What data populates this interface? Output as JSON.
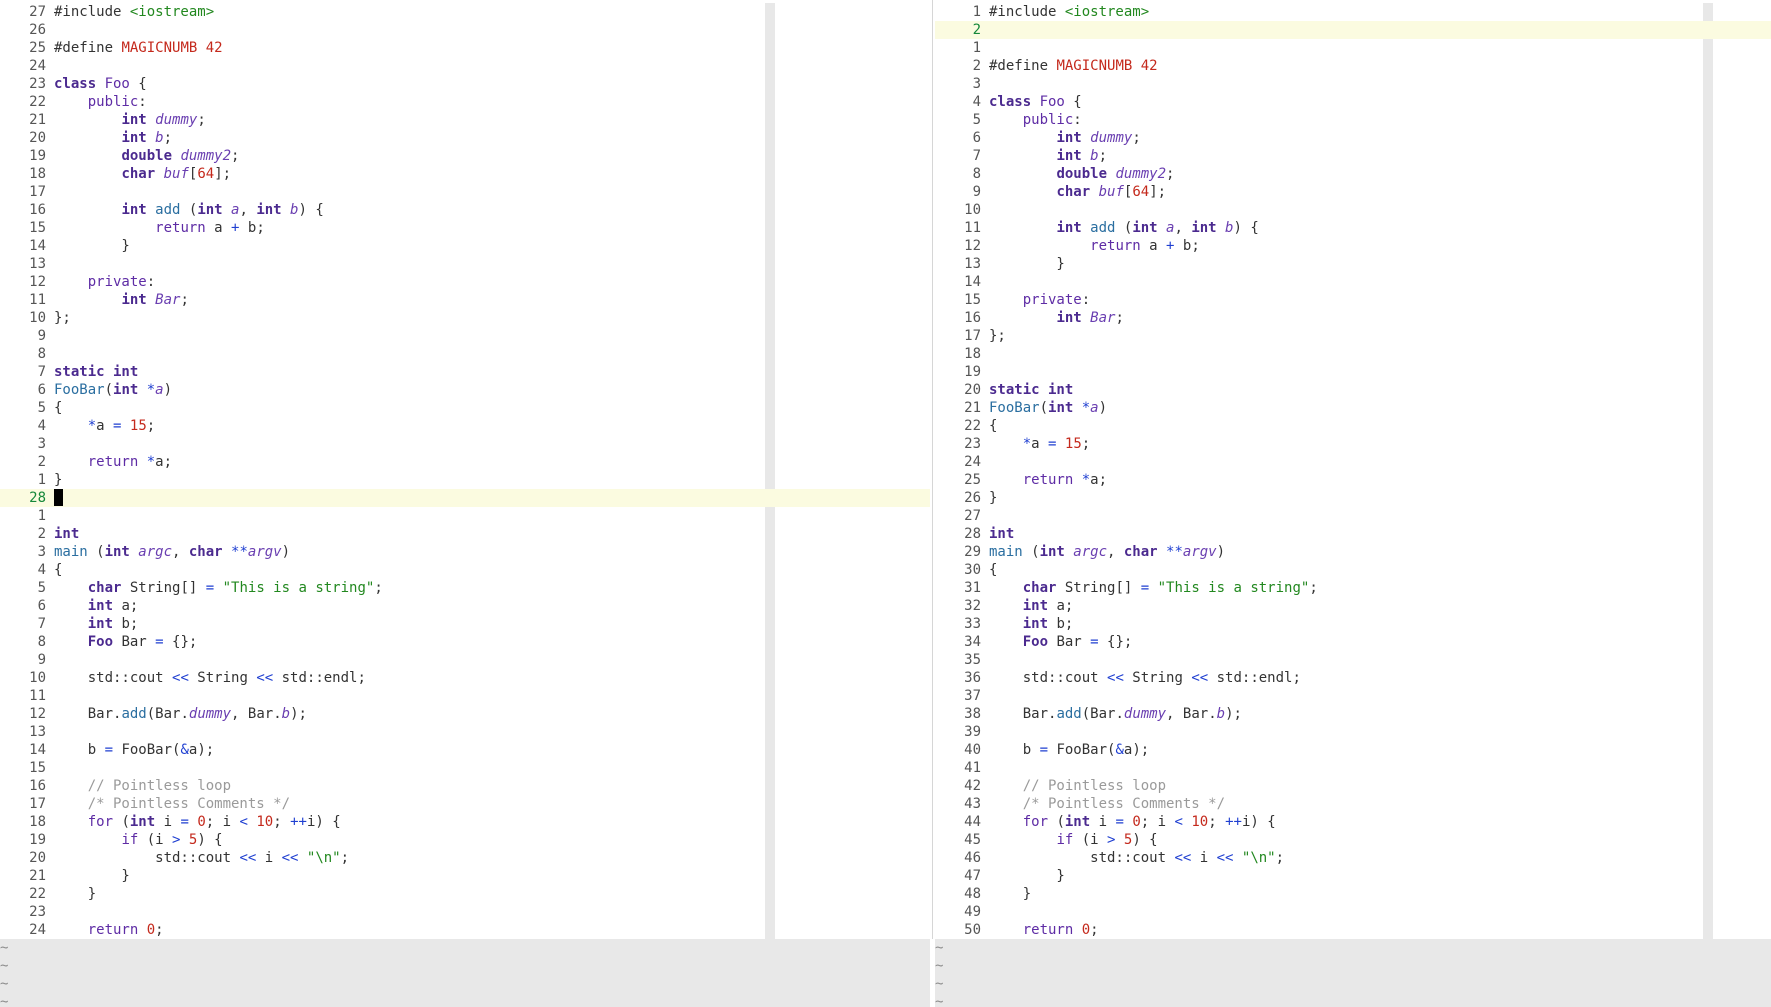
{
  "left_pane": {
    "relnumbers": [
      "27",
      "26",
      "25",
      "24",
      "23",
      "22",
      "21",
      "20",
      "19",
      "18",
      "17",
      "16",
      "15",
      "14",
      "13",
      "12",
      "11",
      "10",
      "9",
      "8",
      "7",
      "6",
      "5",
      "4",
      "3",
      "2",
      "1",
      "28",
      "1",
      "2",
      "3",
      "4",
      "5",
      "6",
      "7",
      "8",
      "9",
      "10",
      "11",
      "12",
      "13",
      "14",
      "15",
      "16",
      "17",
      "18",
      "19",
      "20",
      "21",
      "22",
      "23",
      "24"
    ],
    "cursor_line": "28",
    "tildes": [
      "~",
      "~",
      "~",
      "~"
    ]
  },
  "right_pane": {
    "numbers": [
      "1",
      "2",
      "1",
      "2",
      "3",
      "4",
      "5",
      "6",
      "7",
      "8",
      "9",
      "10",
      "11",
      "12",
      "13",
      "14",
      "15",
      "16",
      "17",
      "18",
      "19",
      "20",
      "21",
      "22",
      "23",
      "24",
      "25",
      "26",
      "27",
      "28",
      "29",
      "30",
      "31",
      "32",
      "33",
      "34",
      "35",
      "36",
      "37",
      "38",
      "39",
      "40",
      "41",
      "42",
      "43",
      "44",
      "45",
      "46",
      "47",
      "48",
      "49",
      "50"
    ],
    "tildes": [
      "~",
      "~",
      "~",
      "~"
    ]
  },
  "code": [
    [
      [
        "pp",
        "#include "
      ],
      [
        "inc",
        "<iostream>"
      ]
    ],
    [],
    [
      [
        "pp",
        "#define "
      ],
      [
        "n",
        "MAGICNUMB 42"
      ]
    ],
    [],
    [
      [
        "k",
        "class "
      ],
      [
        "t",
        "Foo"
      ],
      [
        "pp",
        " {"
      ]
    ],
    [
      [
        "pp",
        "    "
      ],
      [
        "t",
        "public"
      ],
      [
        "pp",
        ":"
      ]
    ],
    [
      [
        "pp",
        "        "
      ],
      [
        "k",
        "int "
      ],
      [
        "v",
        "dummy"
      ],
      [
        "pp",
        ";"
      ]
    ],
    [
      [
        "pp",
        "        "
      ],
      [
        "k",
        "int "
      ],
      [
        "v",
        "b"
      ],
      [
        "pp",
        ";"
      ]
    ],
    [
      [
        "pp",
        "        "
      ],
      [
        "k",
        "double "
      ],
      [
        "v",
        "dummy2"
      ],
      [
        "pp",
        ";"
      ]
    ],
    [
      [
        "pp",
        "        "
      ],
      [
        "k",
        "char "
      ],
      [
        "v",
        "buf"
      ],
      [
        "pp",
        "["
      ],
      [
        "n",
        "64"
      ],
      [
        "pp",
        "];"
      ]
    ],
    [],
    [
      [
        "pp",
        "        "
      ],
      [
        "k",
        "int "
      ],
      [
        "f",
        "add"
      ],
      [
        "pp",
        " ("
      ],
      [
        "k",
        "int "
      ],
      [
        "v",
        "a"
      ],
      [
        "pp",
        ", "
      ],
      [
        "k",
        "int "
      ],
      [
        "v",
        "b"
      ],
      [
        "pp",
        ") {"
      ]
    ],
    [
      [
        "pp",
        "            "
      ],
      [
        "t",
        "return"
      ],
      [
        "pp",
        " a "
      ],
      [
        "o",
        "+"
      ],
      [
        "pp",
        " b;"
      ]
    ],
    [
      [
        "pp",
        "        }"
      ]
    ],
    [],
    [
      [
        "pp",
        "    "
      ],
      [
        "t",
        "private"
      ],
      [
        "pp",
        ":"
      ]
    ],
    [
      [
        "pp",
        "        "
      ],
      [
        "k",
        "int "
      ],
      [
        "v",
        "Bar"
      ],
      [
        "pp",
        ";"
      ]
    ],
    [
      [
        "pp",
        "};"
      ]
    ],
    [],
    [],
    [
      [
        "k",
        "static int"
      ]
    ],
    [
      [
        "f",
        "FooBar"
      ],
      [
        "pp",
        "("
      ],
      [
        "k",
        "int "
      ],
      [
        "o",
        "*"
      ],
      [
        "v",
        "a"
      ],
      [
        "pp",
        ")"
      ]
    ],
    [
      [
        "pp",
        "{"
      ]
    ],
    [
      [
        "pp",
        "    "
      ],
      [
        "o",
        "*"
      ],
      [
        "pp",
        "a "
      ],
      [
        "o",
        "="
      ],
      [
        "pp",
        " "
      ],
      [
        "n",
        "15"
      ],
      [
        "pp",
        ";"
      ]
    ],
    [],
    [
      [
        "pp",
        "    "
      ],
      [
        "t",
        "return"
      ],
      [
        "pp",
        " "
      ],
      [
        "o",
        "*"
      ],
      [
        "pp",
        "a;"
      ]
    ],
    [
      [
        "pp",
        "}"
      ]
    ],
    [],
    [
      [
        "k",
        "int"
      ]
    ],
    [
      [
        "f",
        "main"
      ],
      [
        "pp",
        " ("
      ],
      [
        "k",
        "int "
      ],
      [
        "v",
        "argc"
      ],
      [
        "pp",
        ", "
      ],
      [
        "k",
        "char "
      ],
      [
        "o",
        "**"
      ],
      [
        "v",
        "argv"
      ],
      [
        "pp",
        ")"
      ]
    ],
    [
      [
        "pp",
        "{"
      ]
    ],
    [
      [
        "pp",
        "    "
      ],
      [
        "k",
        "char "
      ],
      [
        "pp",
        "String[] "
      ],
      [
        "o",
        "="
      ],
      [
        "pp",
        " "
      ],
      [
        "s",
        "\"This is a string\""
      ],
      [
        "pp",
        ";"
      ]
    ],
    [
      [
        "pp",
        "    "
      ],
      [
        "k",
        "int "
      ],
      [
        "pp",
        "a;"
      ]
    ],
    [
      [
        "pp",
        "    "
      ],
      [
        "k",
        "int "
      ],
      [
        "pp",
        "b;"
      ]
    ],
    [
      [
        "pp",
        "    "
      ],
      [
        "k",
        "Foo "
      ],
      [
        "pp",
        "Bar "
      ],
      [
        "o",
        "="
      ],
      [
        "pp",
        " {};"
      ]
    ],
    [],
    [
      [
        "pp",
        "    std::cout "
      ],
      [
        "o",
        "<<"
      ],
      [
        "pp",
        " String "
      ],
      [
        "o",
        "<<"
      ],
      [
        "pp",
        " std::endl;"
      ]
    ],
    [],
    [
      [
        "pp",
        "    Bar."
      ],
      [
        "f",
        "add"
      ],
      [
        "pp",
        "(Bar."
      ],
      [
        "v",
        "dummy"
      ],
      [
        "pp",
        ", Bar."
      ],
      [
        "v",
        "b"
      ],
      [
        "pp",
        ");"
      ]
    ],
    [],
    [
      [
        "pp",
        "    b "
      ],
      [
        "o",
        "="
      ],
      [
        "pp",
        " FooBar("
      ],
      [
        "o",
        "&"
      ],
      [
        "pp",
        "a);"
      ]
    ],
    [],
    [
      [
        "pp",
        "    "
      ],
      [
        "c",
        "// Pointless loop"
      ]
    ],
    [
      [
        "pp",
        "    "
      ],
      [
        "c",
        "/* Pointless Comments */"
      ]
    ],
    [
      [
        "pp",
        "    "
      ],
      [
        "t",
        "for"
      ],
      [
        "pp",
        " ("
      ],
      [
        "k",
        "int "
      ],
      [
        "pp",
        "i "
      ],
      [
        "o",
        "="
      ],
      [
        "pp",
        " "
      ],
      [
        "n",
        "0"
      ],
      [
        "pp",
        "; i "
      ],
      [
        "o",
        "<"
      ],
      [
        "pp",
        " "
      ],
      [
        "n",
        "10"
      ],
      [
        "pp",
        "; "
      ],
      [
        "o",
        "++"
      ],
      [
        "pp",
        "i) {"
      ]
    ],
    [
      [
        "pp",
        "        "
      ],
      [
        "t",
        "if"
      ],
      [
        "pp",
        " (i "
      ],
      [
        "o",
        ">"
      ],
      [
        "pp",
        " "
      ],
      [
        "n",
        "5"
      ],
      [
        "pp",
        ") {"
      ]
    ],
    [
      [
        "pp",
        "            std::cout "
      ],
      [
        "o",
        "<<"
      ],
      [
        "pp",
        " i "
      ],
      [
        "o",
        "<<"
      ],
      [
        "pp",
        " "
      ],
      [
        "s",
        "\"\\n\""
      ],
      [
        "pp",
        ";"
      ]
    ],
    [
      [
        "pp",
        "        }"
      ]
    ],
    [
      [
        "pp",
        "    }"
      ]
    ],
    [],
    [
      [
        "pp",
        "    "
      ],
      [
        "t",
        "return"
      ],
      [
        "pp",
        " "
      ],
      [
        "n",
        "0"
      ],
      [
        "pp",
        ";"
      ]
    ],
    [
      [
        "pp",
        "}"
      ]
    ]
  ],
  "left_order": [
    0,
    1,
    2,
    3,
    4,
    5,
    6,
    7,
    8,
    9,
    10,
    11,
    12,
    13,
    14,
    15,
    16,
    17,
    18,
    19,
    20,
    21,
    22,
    23,
    24,
    25,
    26,
    "cursor",
    27,
    28,
    29,
    30,
    31,
    32,
    33,
    34,
    35,
    36,
    37,
    38,
    39,
    40,
    41,
    42,
    43,
    44,
    45,
    46,
    47,
    48,
    49,
    50
  ],
  "right_order": [
    0,
    "blank",
    1,
    2,
    3,
    4,
    5,
    6,
    7,
    8,
    9,
    10,
    11,
    12,
    13,
    14,
    15,
    16,
    17,
    18,
    19,
    20,
    21,
    22,
    23,
    24,
    25,
    26,
    27,
    28,
    29,
    30,
    31,
    32,
    33,
    34,
    35,
    36,
    37,
    38,
    39,
    40,
    41,
    42,
    43,
    44,
    45,
    46,
    47,
    48,
    49,
    50
  ],
  "colors": {
    "highlight_line": "#fbfbe0",
    "colorcolumn": "#e8e8e8",
    "cursor": "#000000",
    "current_line_number": "#16883a"
  }
}
